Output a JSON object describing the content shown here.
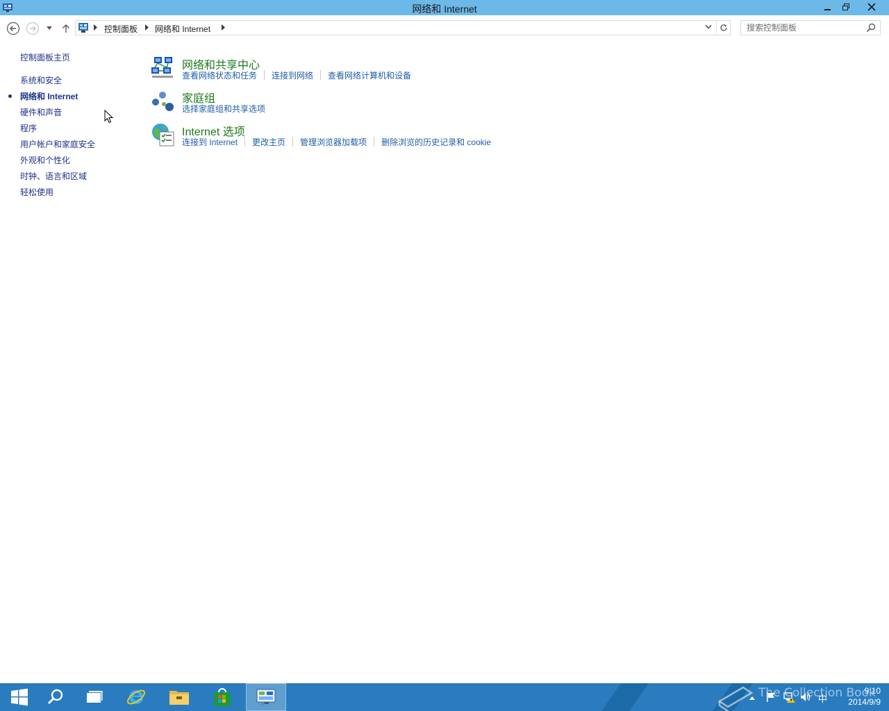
{
  "window": {
    "title": "网络和 Internet"
  },
  "address": {
    "breadcrumbs": [
      "控制面板",
      "网络和 Internet"
    ]
  },
  "search": {
    "placeholder": "搜索控制面板"
  },
  "left_nav": {
    "home": "控制面板主页",
    "items": [
      {
        "label": "系统和安全",
        "current": false
      },
      {
        "label": "网络和 Internet",
        "current": true
      },
      {
        "label": "硬件和声音",
        "current": false
      },
      {
        "label": "程序",
        "current": false
      },
      {
        "label": "用户帐户和家庭安全",
        "current": false
      },
      {
        "label": "外观和个性化",
        "current": false
      },
      {
        "label": "时钟、语言和区域",
        "current": false
      },
      {
        "label": "轻松使用",
        "current": false
      }
    ]
  },
  "categories": [
    {
      "icon": "network-sharing-center-icon",
      "title": "网络和共享中心",
      "links": [
        "查看网络状态和任务",
        "连接到网络",
        "查看网络计算机和设备"
      ]
    },
    {
      "icon": "homegroup-icon",
      "title": "家庭组",
      "links": [
        "选择家庭组和共享选项"
      ]
    },
    {
      "icon": "internet-options-icon",
      "title": "Internet 选项",
      "links": [
        "连接到 Internet",
        "更改主页",
        "管理浏览器加载项",
        "删除浏览的历史记录和 cookie"
      ]
    }
  ],
  "taskbar": {
    "apps": [
      "start-icon",
      "search-icon",
      "task-view-icon",
      "internet-explorer-icon",
      "file-explorer-icon",
      "store-icon",
      "control-panel-icon"
    ],
    "active_app": "control-panel-icon",
    "tray_ime": "中",
    "clock_time": "9:10",
    "clock_date": "2014/9/9",
    "watermark": "The Collection Book"
  },
  "colors": {
    "titlebar": "#6cb8e8",
    "taskbar": "#2a7cbf",
    "heading_green": "#1e7a1e",
    "link_blue": "#1e5ea8",
    "nav_blue": "#1e3287"
  }
}
